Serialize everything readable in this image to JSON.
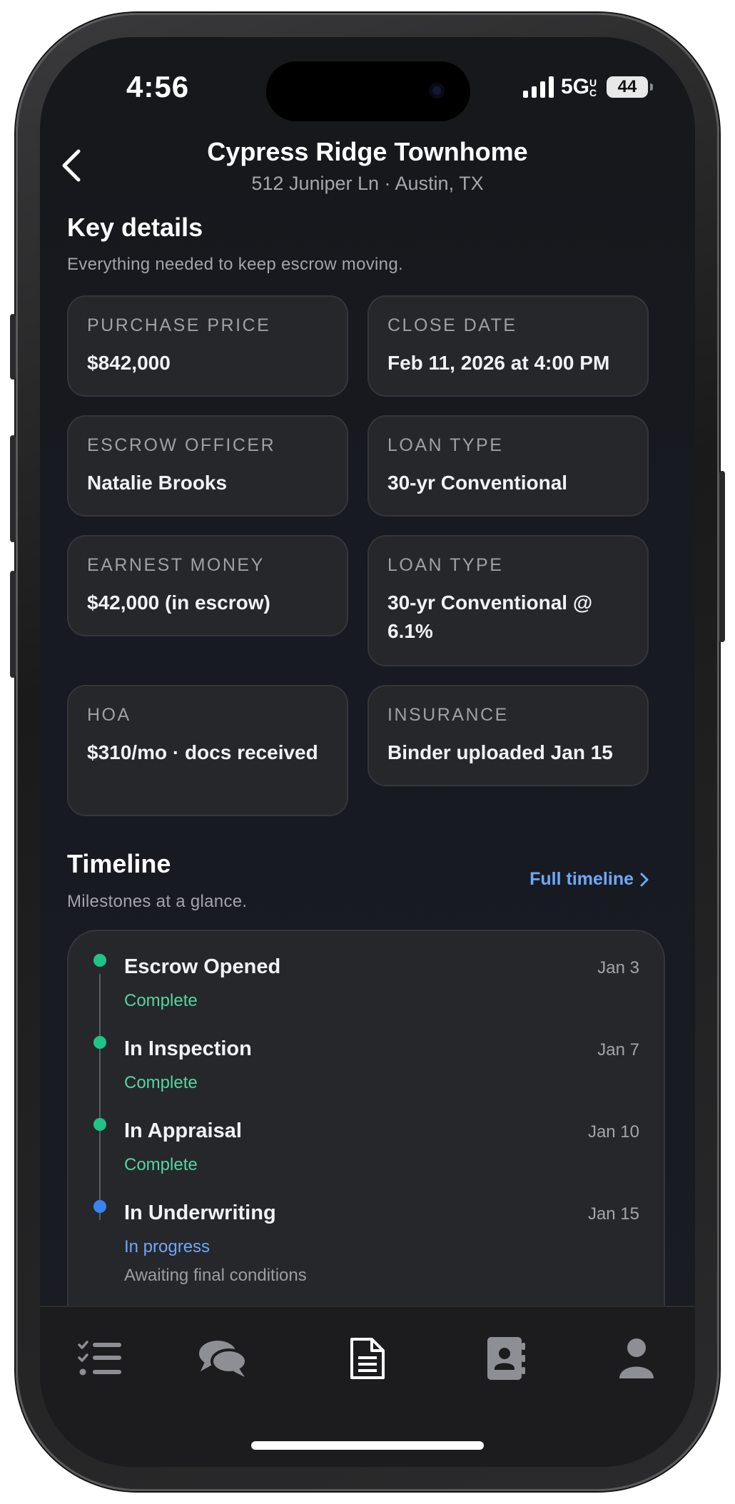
{
  "status": {
    "time": "4:56",
    "network": "5G",
    "network_sup": "UC",
    "battery": "44"
  },
  "header": {
    "title": "Cypress Ridge Townhome",
    "subtitle": "512 Juniper Ln · Austin, TX"
  },
  "key_details": {
    "title": "Key details",
    "subtitle": "Everything needed to keep escrow moving.",
    "cards": [
      {
        "label": "PURCHASE PRICE",
        "value": "$842,000"
      },
      {
        "label": "CLOSE DATE",
        "value": "Feb 11, 2026 at 4:00 PM"
      },
      {
        "label": "ESCROW OFFICER",
        "value": "Natalie Brooks"
      },
      {
        "label": "LOAN TYPE",
        "value": "30-yr Conventional"
      },
      {
        "label": "EARNEST MONEY",
        "value": "$42,000 (in escrow)"
      },
      {
        "label": "LOAN TYPE",
        "value": "30-yr Conventional @ 6.1%"
      },
      {
        "label": "HOA",
        "value": "$310/mo · docs received"
      },
      {
        "label": "INSURANCE",
        "value": "Binder uploaded Jan 15"
      }
    ]
  },
  "timeline": {
    "title": "Timeline",
    "subtitle": "Milestones at a glance.",
    "link_label": "Full timeline",
    "items": [
      {
        "title": "Escrow Opened",
        "date": "Jan 3",
        "status": "Complete",
        "note": ""
      },
      {
        "title": "In Inspection",
        "date": "Jan 7",
        "status": "Complete",
        "note": ""
      },
      {
        "title": "In Appraisal",
        "date": "Jan 10",
        "status": "Complete",
        "note": ""
      },
      {
        "title": "In Underwriting",
        "date": "Jan 15",
        "status": "In progress",
        "note": "Awaiting final conditions"
      }
    ]
  },
  "tabs": [
    {
      "icon": "checklist-icon",
      "active": false
    },
    {
      "icon": "chat-bubbles-icon",
      "active": false
    },
    {
      "icon": "document-icon",
      "active": true
    },
    {
      "icon": "contact-book-icon",
      "active": false
    },
    {
      "icon": "person-icon",
      "active": false
    }
  ],
  "colors": {
    "complete": "#52d6a0",
    "in_progress": "#6fa8f7",
    "dot_complete": "#1fc486",
    "dot_progress": "#3b82f6",
    "link": "#6fa8f7"
  }
}
